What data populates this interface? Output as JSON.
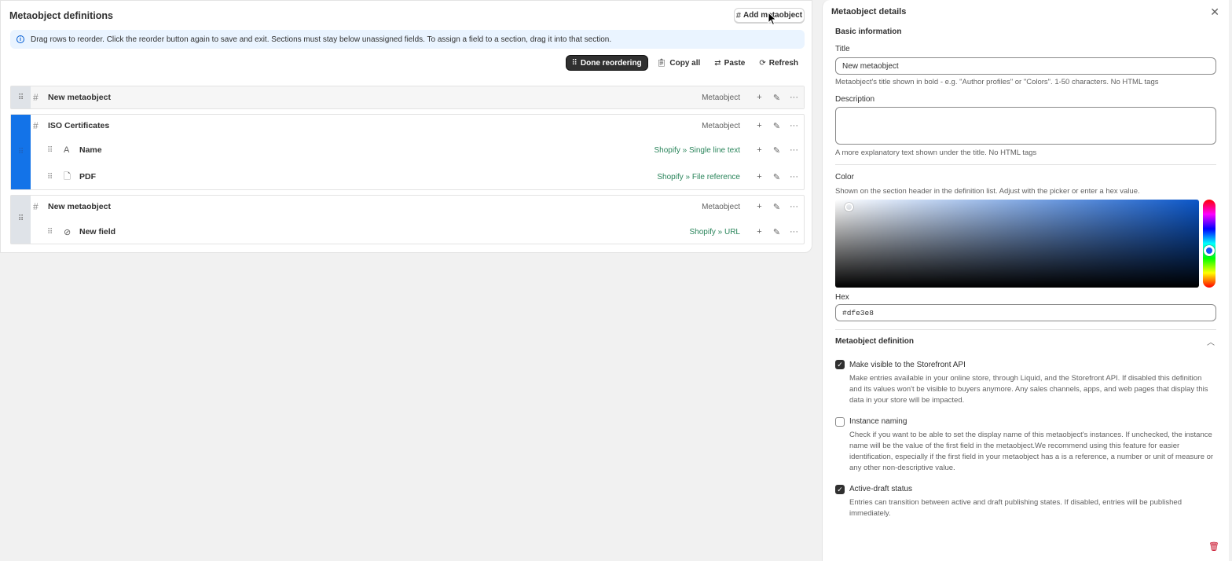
{
  "left": {
    "title": "Metaobject definitions",
    "add_button": "Add metaobject",
    "banner": "Drag rows to reorder. Click the reorder button again to save and exit. Sections must stay below unassigned fields. To assign a field to a section, drag it into that section.",
    "toolbar": {
      "done": "Done reordering",
      "copy": "Copy all",
      "paste": "Paste",
      "refresh": "Refresh"
    },
    "groups": [
      {
        "title": "New metaobject",
        "type": "Metaobject",
        "color": "#dfe3e8",
        "fields": []
      },
      {
        "title": "ISO Certificates",
        "type": "Metaobject",
        "color": "#1373e8",
        "fields": [
          {
            "name": "Name",
            "type": "Shopify » Single line text",
            "icon": "text-icon"
          },
          {
            "name": "PDF",
            "type": "Shopify » File reference",
            "icon": "file-icon"
          }
        ]
      },
      {
        "title": "New metaobject",
        "type": "Metaobject",
        "color": "#dfe3e8",
        "fields": [
          {
            "name": "New field",
            "type": "Shopify » URL",
            "icon": "link-icon"
          }
        ]
      }
    ]
  },
  "details": {
    "title": "Metaobject details",
    "basic_info": "Basic information",
    "title_label": "Title",
    "title_value": "New metaobject",
    "title_hint": "Metaobject's title shown in bold - e.g. \"Author profiles\" or \"Colors\". 1-50 characters. No HTML tags",
    "description_label": "Description",
    "description_value": "",
    "description_hint": "A more explanatory text shown under the title. No HTML tags",
    "color_label": "Color",
    "color_hint": "Shown on the section header in the definition list. Adjust with the picker or enter a hex value.",
    "hex_label": "Hex",
    "hex_value": "#dfe3e8",
    "definition_title": "Metaobject definition",
    "options": [
      {
        "label": "Make visible to the Storefront API",
        "checked": true,
        "desc": "Make entries available in your online store, through Liquid, and the Storefront API. If disabled this definition and its values won't be visible to buyers anymore. Any sales channels, apps, and web pages that display this data in your store will be impacted."
      },
      {
        "label": "Instance naming",
        "checked": false,
        "desc": "Check if you want to be able to set the display name of this metaobject's instances. If unchecked, the instance name will be the value of the first field in the metaobject.We recommend using this feature for easier identification, especially if the first field in your metaobject has a is a reference, a number or unit of measure or any other non-descriptive value."
      },
      {
        "label": "Active-draft status",
        "checked": true,
        "desc": "Entries can transition between active and draft publishing states. If disabled, entries will be published immediately."
      }
    ]
  },
  "colors": {
    "accent": "#1373e8",
    "primary": "#303030",
    "green": "#29845a",
    "danger": "#c70a24"
  }
}
